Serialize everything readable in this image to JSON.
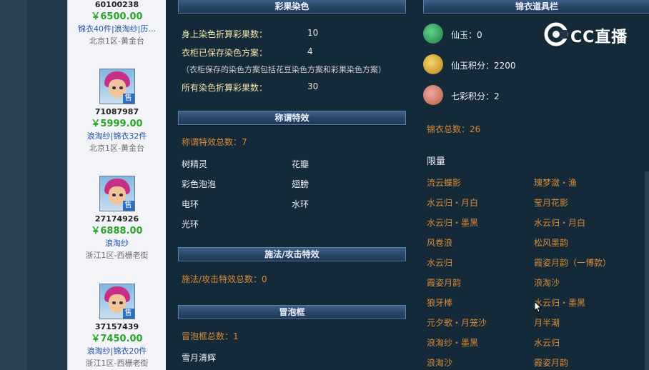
{
  "listings": [
    {
      "id": "60100238",
      "price": "￥6500.00",
      "desc": "锦衣40件|浪淘纱|历...",
      "server": "北京1区-黄金台"
    },
    {
      "id": "71087987",
      "price": "￥5999.00",
      "desc": "浪淘纱|锦衣32件",
      "server": "北京1区-黄金台",
      "badge": "售"
    },
    {
      "id": "27174926",
      "price": "￥6888.00",
      "desc": "浪淘纱",
      "server": "浙江1区-西栅老街",
      "badge": "售"
    },
    {
      "id": "37157439",
      "price": "￥7450.00",
      "desc": "浪淘纱|锦衣20件",
      "server": "浙江1区-西栅老街",
      "badge": "售"
    }
  ],
  "dye": {
    "title": "彩果染色",
    "rows": [
      {
        "label": "身上染色折算彩果数：",
        "value": "10"
      },
      {
        "label": "衣柜已保存染色方案：",
        "value": "4"
      },
      {
        "label": "所有染色折算彩果数：",
        "value": "30"
      }
    ],
    "note": "（衣柜保存的染色方案包括花豆染色方案和彩果染色方案）"
  },
  "title_effects": {
    "title": "称谓特效",
    "total": "称谓特效总数：7",
    "items": [
      "树精灵",
      "花瓣",
      "彩色泡泡",
      "翅膀",
      "电环",
      "水环",
      "光环"
    ]
  },
  "spell_effects": {
    "title": "施法/攻击特效",
    "total": "施法/攻击特效总数：0"
  },
  "bubble": {
    "title": "冒泡框",
    "total": "冒泡框总数：1",
    "items": [
      "雪月清辉"
    ]
  },
  "jinyi": {
    "title": "锦衣道具栏",
    "xianyu": "仙玉：0",
    "xianyu_points": "仙玉积分：2200",
    "qicai_points": "七彩积分：2",
    "total": "锦衣总数：26",
    "limited_label": "限量",
    "items": [
      [
        "流云蝶影",
        "瑰梦潋・渔"
      ],
      [
        "水云归・月白",
        "莹月花影"
      ],
      [
        "水云归・墨黑",
        "水云归・月白"
      ],
      [
        "风卷浪",
        "松风墨韵"
      ],
      [
        "水云归",
        "霞姿月韵（一博款）"
      ],
      [
        "霞姿月韵",
        "浪淘沙"
      ],
      [
        "狼牙棒",
        "水云归・墨黑"
      ],
      [
        "元夕歌・月笼沙",
        "月半潮"
      ],
      [
        "浪淘纱・墨黑",
        "水云归"
      ],
      [
        "浪淘沙",
        "霞姿月韵"
      ]
    ]
  },
  "watermark": "CC直播",
  "colors": {
    "accent_green": "#2aa62a",
    "link_blue": "#1f4fa6",
    "label_yellow": "#f3e6b0",
    "orange": "#d98b3a"
  }
}
